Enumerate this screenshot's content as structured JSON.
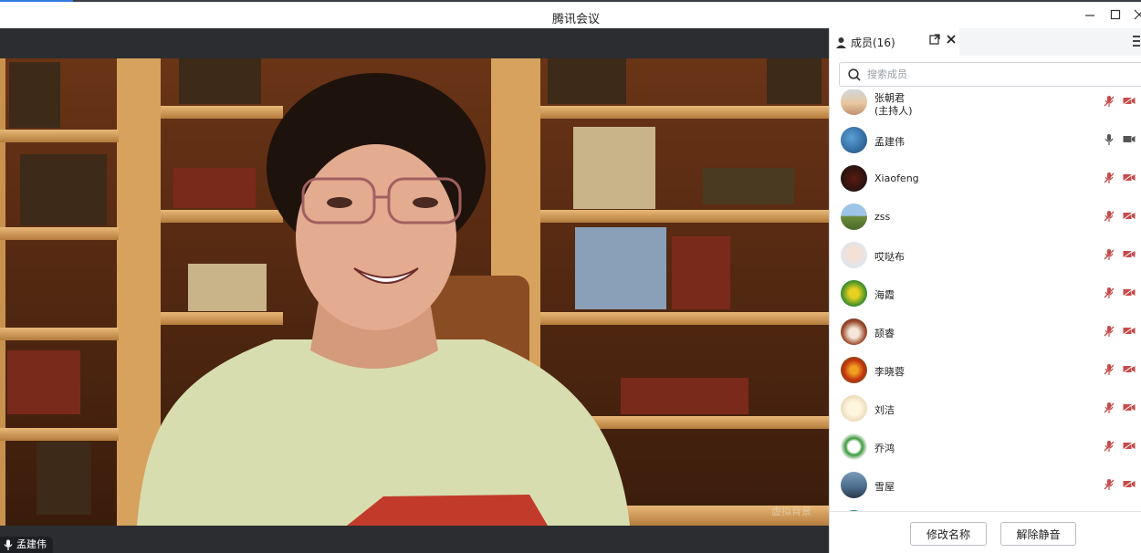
{
  "window": {
    "title": "腾讯会议"
  },
  "video": {
    "speaker_name": "孟建伟",
    "watermark": "虚拟背景"
  },
  "panel": {
    "tab_label": "成员(16)",
    "search_placeholder": "搜索成员",
    "members": [
      {
        "name": "张朝君",
        "sub": "(主持人)",
        "mic": "muted",
        "cam": "off"
      },
      {
        "name": "孟建伟",
        "mic": "on",
        "cam": "on"
      },
      {
        "name": "Xiaofeng",
        "mic": "muted",
        "cam": "off"
      },
      {
        "name": "zss",
        "mic": "muted",
        "cam": "off"
      },
      {
        "name": "哎哒布",
        "mic": "muted",
        "cam": "off"
      },
      {
        "name": "海霞",
        "mic": "muted",
        "cam": "off"
      },
      {
        "name": "颉睿",
        "mic": "muted",
        "cam": "off"
      },
      {
        "name": "李晓蓉",
        "mic": "muted",
        "cam": "off"
      },
      {
        "name": "刘洁",
        "mic": "muted",
        "cam": "off"
      },
      {
        "name": "乔鸿",
        "mic": "muted",
        "cam": "off"
      },
      {
        "name": "雪屋",
        "mic": "muted",
        "cam": "off"
      }
    ],
    "rename_button": "修改名称",
    "unmute_button": "解除静音"
  }
}
